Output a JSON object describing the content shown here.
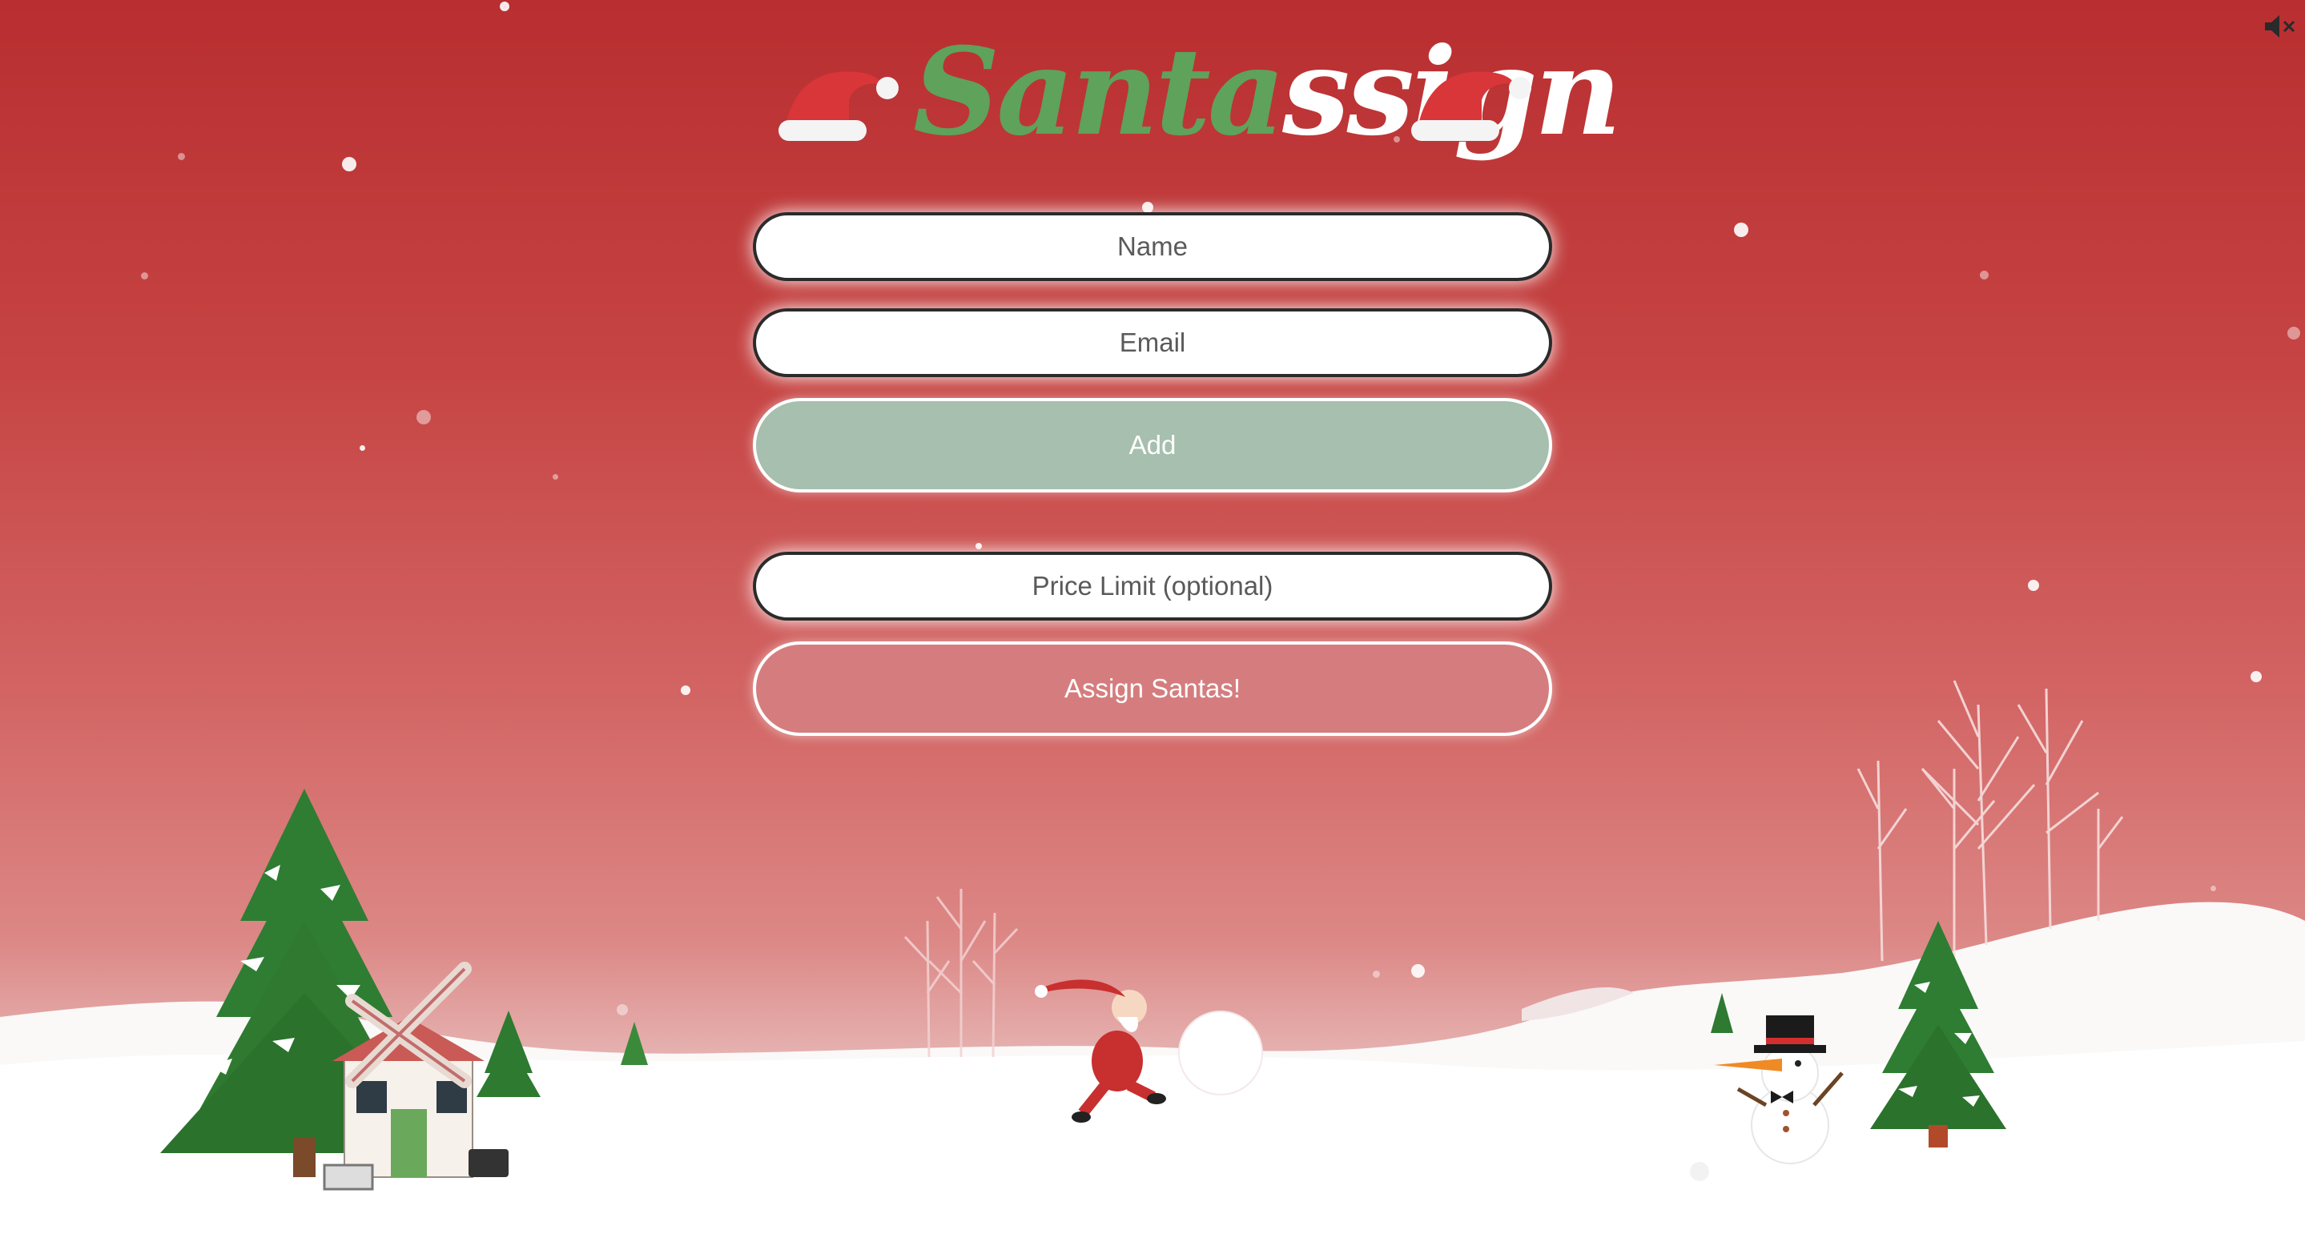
{
  "app": {
    "logo_part1": "Santa",
    "logo_part2": "ssign"
  },
  "form": {
    "name_placeholder": "Name",
    "email_placeholder": "Email",
    "add_label": "Add",
    "price_placeholder": "Price Limit (optional)",
    "assign_label": "Assign Santas!"
  },
  "icons": {
    "mute": "speaker-muted-icon",
    "hat": "santa-hat-icon"
  },
  "colors": {
    "logo_green": "#5ea25c",
    "add_button": "#a7bfae",
    "assign_button": "#d57d7e",
    "background_top": "#b92e30"
  }
}
